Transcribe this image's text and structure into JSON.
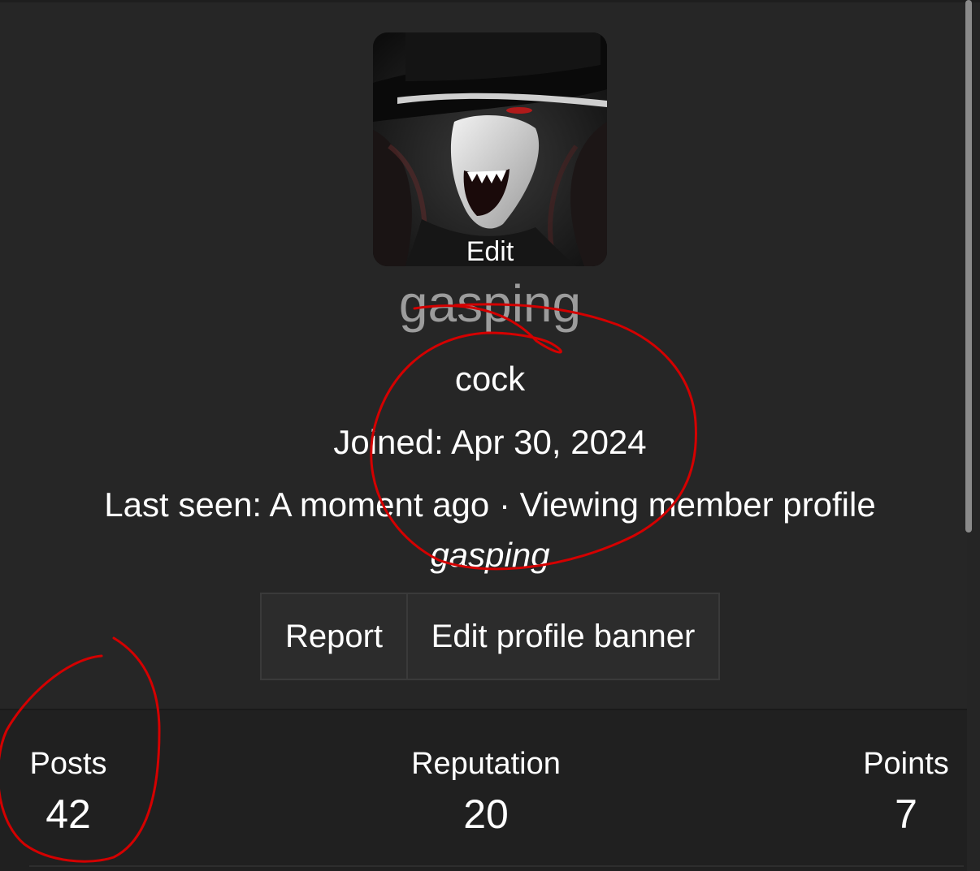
{
  "profile": {
    "avatar_edit_label": "Edit",
    "username": "gasping",
    "user_title": "cock",
    "joined_text": "Joined: Apr 30, 2024",
    "last_seen_text": "Last seen: A moment ago · Viewing member profile",
    "last_seen_target": "gasping"
  },
  "actions": {
    "report_label": "Report",
    "edit_banner_label": "Edit profile banner"
  },
  "stats": [
    {
      "label": "Posts",
      "value": "42"
    },
    {
      "label": "Reputation",
      "value": "20"
    },
    {
      "label": "Points",
      "value": "7"
    }
  ],
  "colors": {
    "background": "#252525",
    "stats_background": "#202020",
    "username_color": "#9c9c9c",
    "annotation_color": "#d40000"
  },
  "icons": {
    "avatar": "vampire-avatar-image"
  }
}
